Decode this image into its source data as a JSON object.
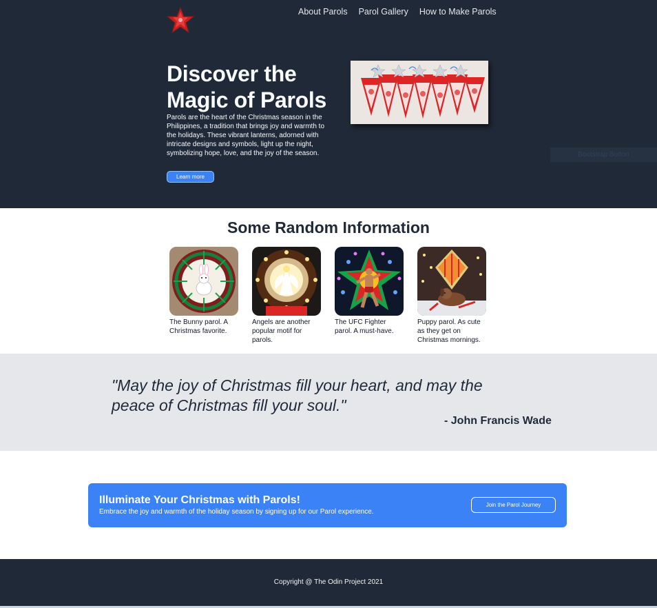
{
  "header": {
    "logo_icon": "star-parol-icon",
    "nav": [
      "About Parols",
      "Parol Gallery",
      "How to Make Parols"
    ]
  },
  "hero": {
    "title": "Discover the Magic of Parols",
    "text": "Parols are the heart of the Christmas season in the Philippines, a tradition that brings joy and warmth to the holidays. These vibrant lanterns, adorned with intricate designs and symbols, light up the night, symbolizing hope, love, and the joy of the season.",
    "button": "Learn more",
    "ghost_label": "Bootstrap Button"
  },
  "info": {
    "title": "Some Random Information",
    "cards": [
      {
        "caption": "The Bunny parol. A Christmas favorite.",
        "image": "bunny-parol-image"
      },
      {
        "caption": "Angels are another popular motif for parols.",
        "image": "angel-parol-image"
      },
      {
        "caption": "The UFC Fighter parol. A must-have.",
        "image": "ufc-fighter-parol-image"
      },
      {
        "caption": "Puppy parol. As cute as they get on Christmas mornings.",
        "image": "puppy-parol-image"
      }
    ]
  },
  "quote": {
    "text": "\"May the joy of Christmas fill your heart, and may the peace of Christmas fill your soul.\"",
    "author": "- John Francis Wade"
  },
  "cta": {
    "title": "Illuminate Your Christmas with Parols!",
    "text": "Embrace the joy and warmth of the holiday season by signing up for our Parol experience.",
    "button": "Join the Parol Journey"
  },
  "footer": {
    "text": "Copyright @ The Odin Project 2021"
  },
  "colors": {
    "dark": "#1f2937",
    "accent": "#3b82f6",
    "quote_bg": "#e5e7eb"
  }
}
